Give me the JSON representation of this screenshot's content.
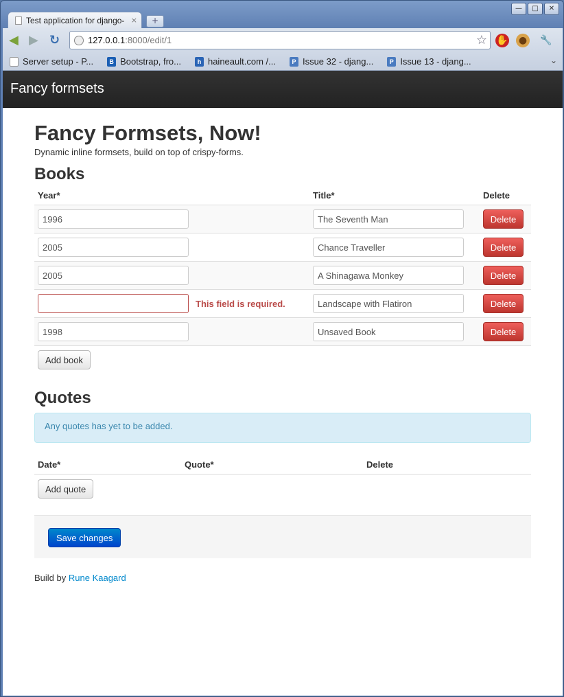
{
  "browser": {
    "tab_title": "Test application for django-",
    "tab_close": "×",
    "new_tab": "+",
    "url_host": "127.0.0.1",
    "url_path": ":8000/edit/1",
    "window_controls": [
      "—",
      "□",
      "✕"
    ],
    "bookmarks": [
      {
        "label": "Server setup - P...",
        "icon": "page-icon"
      },
      {
        "label": "Bootstrap, fro...",
        "icon": "bootstrap-icon",
        "icon_text": "B"
      },
      {
        "label": "haineault.com /...",
        "icon": "haineault-icon",
        "icon_text": "h"
      },
      {
        "label": "Issue 32 - djang...",
        "icon": "issue-icon",
        "icon_text": "P"
      },
      {
        "label": "Issue 13 - djang...",
        "icon": "issue-icon",
        "icon_text": "P"
      }
    ]
  },
  "navbar": {
    "brand": "Fancy formsets"
  },
  "page": {
    "title": "Fancy Formsets, Now!",
    "lead": "Dynamic inline formsets, build on top of crispy-forms."
  },
  "books": {
    "heading": "Books",
    "columns": {
      "year": "Year*",
      "title": "Title*",
      "delete": "Delete"
    },
    "rows": [
      {
        "year": "1996",
        "title": "The Seventh Man",
        "delete": "Delete",
        "error": ""
      },
      {
        "year": "2005",
        "title": "Chance Traveller",
        "delete": "Delete",
        "error": ""
      },
      {
        "year": "2005",
        "title": "A Shinagawa Monkey",
        "delete": "Delete",
        "error": ""
      },
      {
        "year": "",
        "title": "Landscape with Flatiron",
        "delete": "Delete",
        "error": "This field is required."
      },
      {
        "year": "1998",
        "title": "Unsaved Book",
        "delete": "Delete",
        "error": ""
      }
    ],
    "add_label": "Add book"
  },
  "quotes": {
    "heading": "Quotes",
    "alert": "Any quotes has yet to be added.",
    "columns": {
      "date": "Date*",
      "quote": "Quote*",
      "delete": "Delete"
    },
    "add_label": "Add quote"
  },
  "actions": {
    "save_label": "Save changes"
  },
  "footer": {
    "prefix": "Build by",
    "author": "Rune Kaagard"
  },
  "colors": {
    "danger": "#da4f49",
    "primary": "#0088cc",
    "error_text": "#b94a48",
    "info_bg": "#d9edf7"
  }
}
